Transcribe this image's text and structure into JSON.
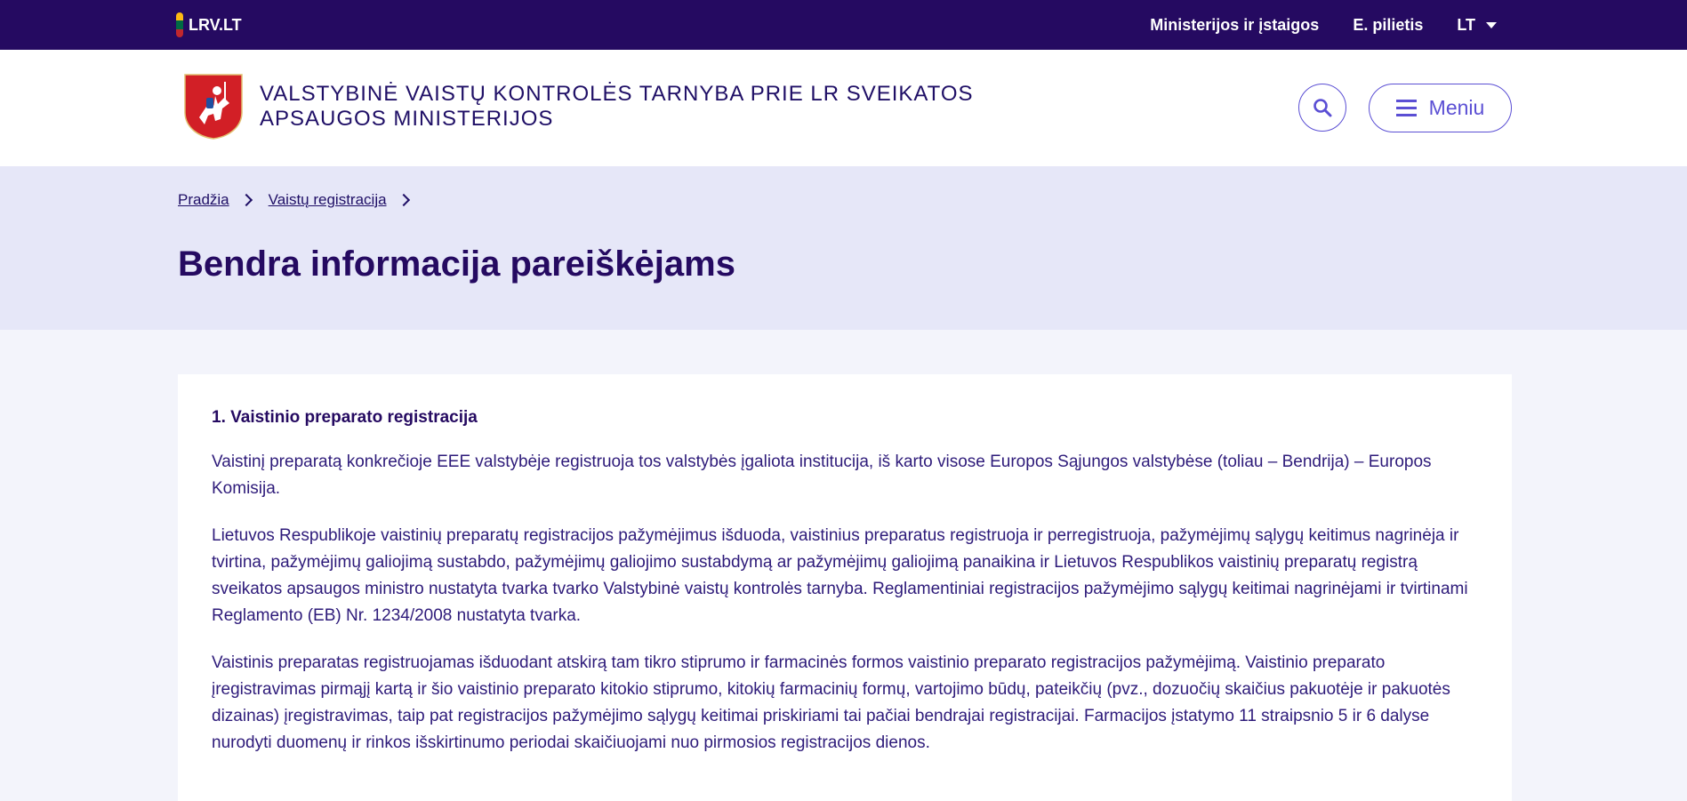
{
  "topbar": {
    "logo_text": "LRV.LT",
    "nav": [
      {
        "label": "Ministerijos ir įstaigos"
      },
      {
        "label": "E. pilietis"
      },
      {
        "label": "LT"
      }
    ]
  },
  "header": {
    "org_name": "VALSTYBINĖ VAISTŲ KONTROLĖS TARNYBA PRIE LR SVEIKATOS APSAUGOS MINISTERIJOS",
    "menu_label": "Meniu"
  },
  "breadcrumb": [
    {
      "label": "Pradžia"
    },
    {
      "label": "Vaistų registracija"
    }
  ],
  "page_title": "Bendra informacija pareiškėjams",
  "content": {
    "section_title": "1. Vaistinio preparato registracija",
    "paragraphs": [
      "Vaistinį preparatą konkrečioje EEE valstybėje registruoja tos valstybės įgaliota institucija, iš karto visose Europos Sąjungos valstybėse (toliau – Bendrija) – Europos Komisija.",
      "Lietuvos Respublikoje vaistinių preparatų registracijos pažymėjimus išduoda, vaistinius preparatus registruoja ir perregistruoja, pažymėjimų sąlygų keitimus nagrinėja ir tvirtina, pažymėjimų galiojimą sustabdo, pažymėjimų galiojimo sustabdymą ar pažymėjimų galiojimą panaikina ir Lietuvos Respublikos vaistinių preparatų registrą sveikatos apsaugos ministro nustatyta tvarka tvarko Valstybinė vaistų kontrolės tarnyba. Reglamentiniai registracijos pažymėjimo sąlygų keitimai nagrinėjami ir tvirtinami Reglamento (EB) Nr. 1234/2008 nustatyta tvarka.",
      "Vaistinis preparatas registruojamas išduodant atskirą tam tikro stiprumo ir farmacinės formos vaistinio preparato registracijos pažymėjimą. Vaistinio preparato įregistravimas pirmąjį kartą ir šio vaistinio preparato kitokio stiprumo, kitokių farmacinių formų, vartojimo būdų, pateikčių (pvz., dozuočių skaičius pakuotėje ir pakuotės dizainas) įregistravimas, taip pat registracijos pažymėjimo sąlygų keitimai priskiriami tai pačiai bendrajai registracijai. Farmacijos įstatymo 11 straipsnio 5 ir 6 dalyse nurodyti duomenų ir rinkos išskirtinumo periodai skaičiuojami nuo pirmosios registracijos dienos."
    ]
  },
  "colors": {
    "topbar_bg": "#250a61",
    "accent": "#5b4fd4",
    "banner_bg": "#e6e7f8",
    "page_bg": "#f3f4fb"
  },
  "icons": [
    "flag-icon",
    "coat-of-arms-icon",
    "search-icon",
    "hamburger-icon",
    "chevron-right-icon",
    "caret-down-icon"
  ]
}
